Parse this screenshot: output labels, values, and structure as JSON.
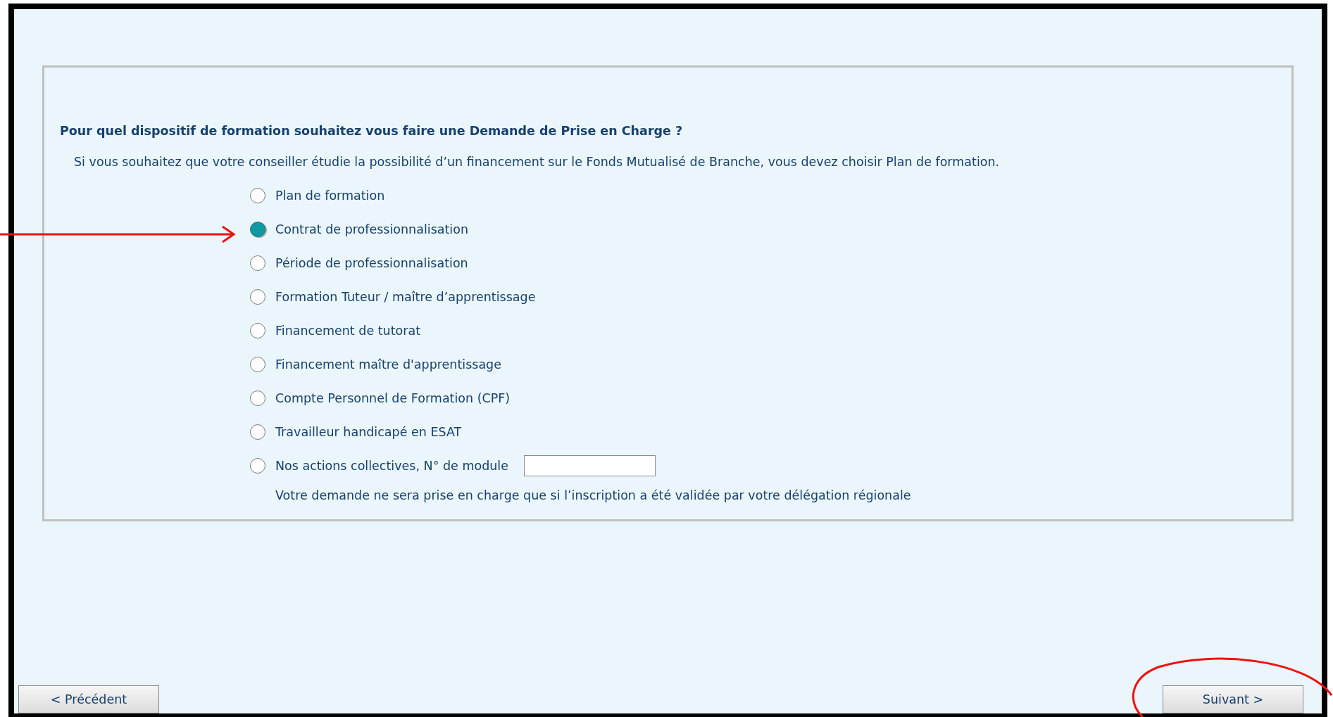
{
  "question": "Pour quel dispositif de formation souhaitez vous faire une Demande de Prise en Charge ?",
  "hint": "Si vous souhaitez que votre conseiller étudie la possibilité d’un financement sur le Fonds Mutualisé de Branche, vous devez choisir Plan de formation.",
  "options": [
    {
      "label": "Plan de formation",
      "selected": false
    },
    {
      "label": "Contrat de professionnalisation",
      "selected": true
    },
    {
      "label": "Période de professionnalisation",
      "selected": false
    },
    {
      "label": "Formation Tuteur / maître d’apprentissage",
      "selected": false
    },
    {
      "label": "Financement de tutorat",
      "selected": false
    },
    {
      "label": "Financement maître d'apprentissage",
      "selected": false
    },
    {
      "label": "Compte Personnel de Formation (CPF)",
      "selected": false
    },
    {
      "label": "Travailleur handicapé en ESAT",
      "selected": false
    },
    {
      "label": "Nos actions collectives, N° de module",
      "selected": false,
      "kind": "with_field"
    }
  ],
  "note": "Votre demande ne sera prise en charge que si l’inscription a été validée par votre délégation régionale",
  "buttons": {
    "previous": "< Précédent",
    "next": "Suivant >"
  }
}
